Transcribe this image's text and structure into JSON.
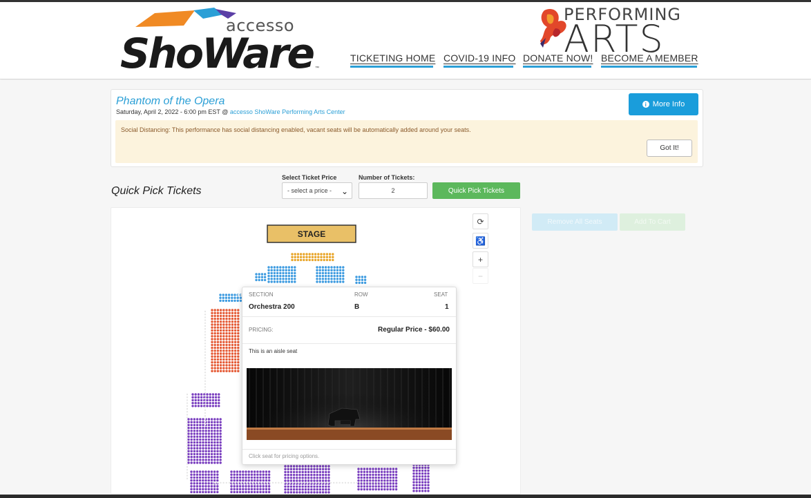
{
  "header": {
    "brand_accesso": "accesso",
    "brand_showare": "ShoWare",
    "brand_tm": "™",
    "partner_line1": "PERFORMING",
    "partner_line2": "ARTS",
    "nav": [
      "TICKETING HOME",
      "COVID-19 INFO",
      "DONATE NOW!",
      "BECOME A MEMBER"
    ]
  },
  "event": {
    "title": "Phantom of the Opera",
    "date_text": "Saturday, April 2, 2022 - 6:00 pm EST @ ",
    "venue": "accesso ShoWare Performing Arts Center",
    "more_info_label": "More Info",
    "notice_text": "Social Distancing: This performance has social distancing enabled, vacant seats will be automatically added around your seats.",
    "got_it_label": "Got It!"
  },
  "quick_pick": {
    "title": "Quick Pick Tickets",
    "price_label": "Select Ticket Price",
    "price_value": "- select a price -",
    "num_label": "Number of Tickets:",
    "num_value": "2",
    "button_label": "Quick Pick Tickets"
  },
  "map": {
    "stage_label": "STAGE",
    "controls": [
      "refresh-icon",
      "wheelchair-icon",
      "zoom-in-icon",
      "zoom-out-icon"
    ],
    "control_glyphs": [
      "⟳",
      "♿",
      "+",
      "−"
    ]
  },
  "cart": {
    "remove_all_label": "Remove All Seats",
    "add_to_cart_label": "Add To Cart"
  },
  "tooltip": {
    "section_label": "SECTION",
    "section_value": "Orchestra 200",
    "row_label": "ROW",
    "row_value": "B",
    "seat_label": "SEAT",
    "seat_value": "1",
    "pricing_label": "PRICING:",
    "price_value": "Regular Price - $60.00",
    "note": "This is an aisle seat",
    "footer": "Click seat for pricing options."
  },
  "colors": {
    "accent_blue": "#1a9ddb",
    "green": "#5cb85c",
    "seat_gold": "#e8a52a",
    "seat_blue": "#3d9be0",
    "seat_red": "#e55a35",
    "seat_purple": "#7a3fbf",
    "stage_fill": "#e9c067"
  }
}
